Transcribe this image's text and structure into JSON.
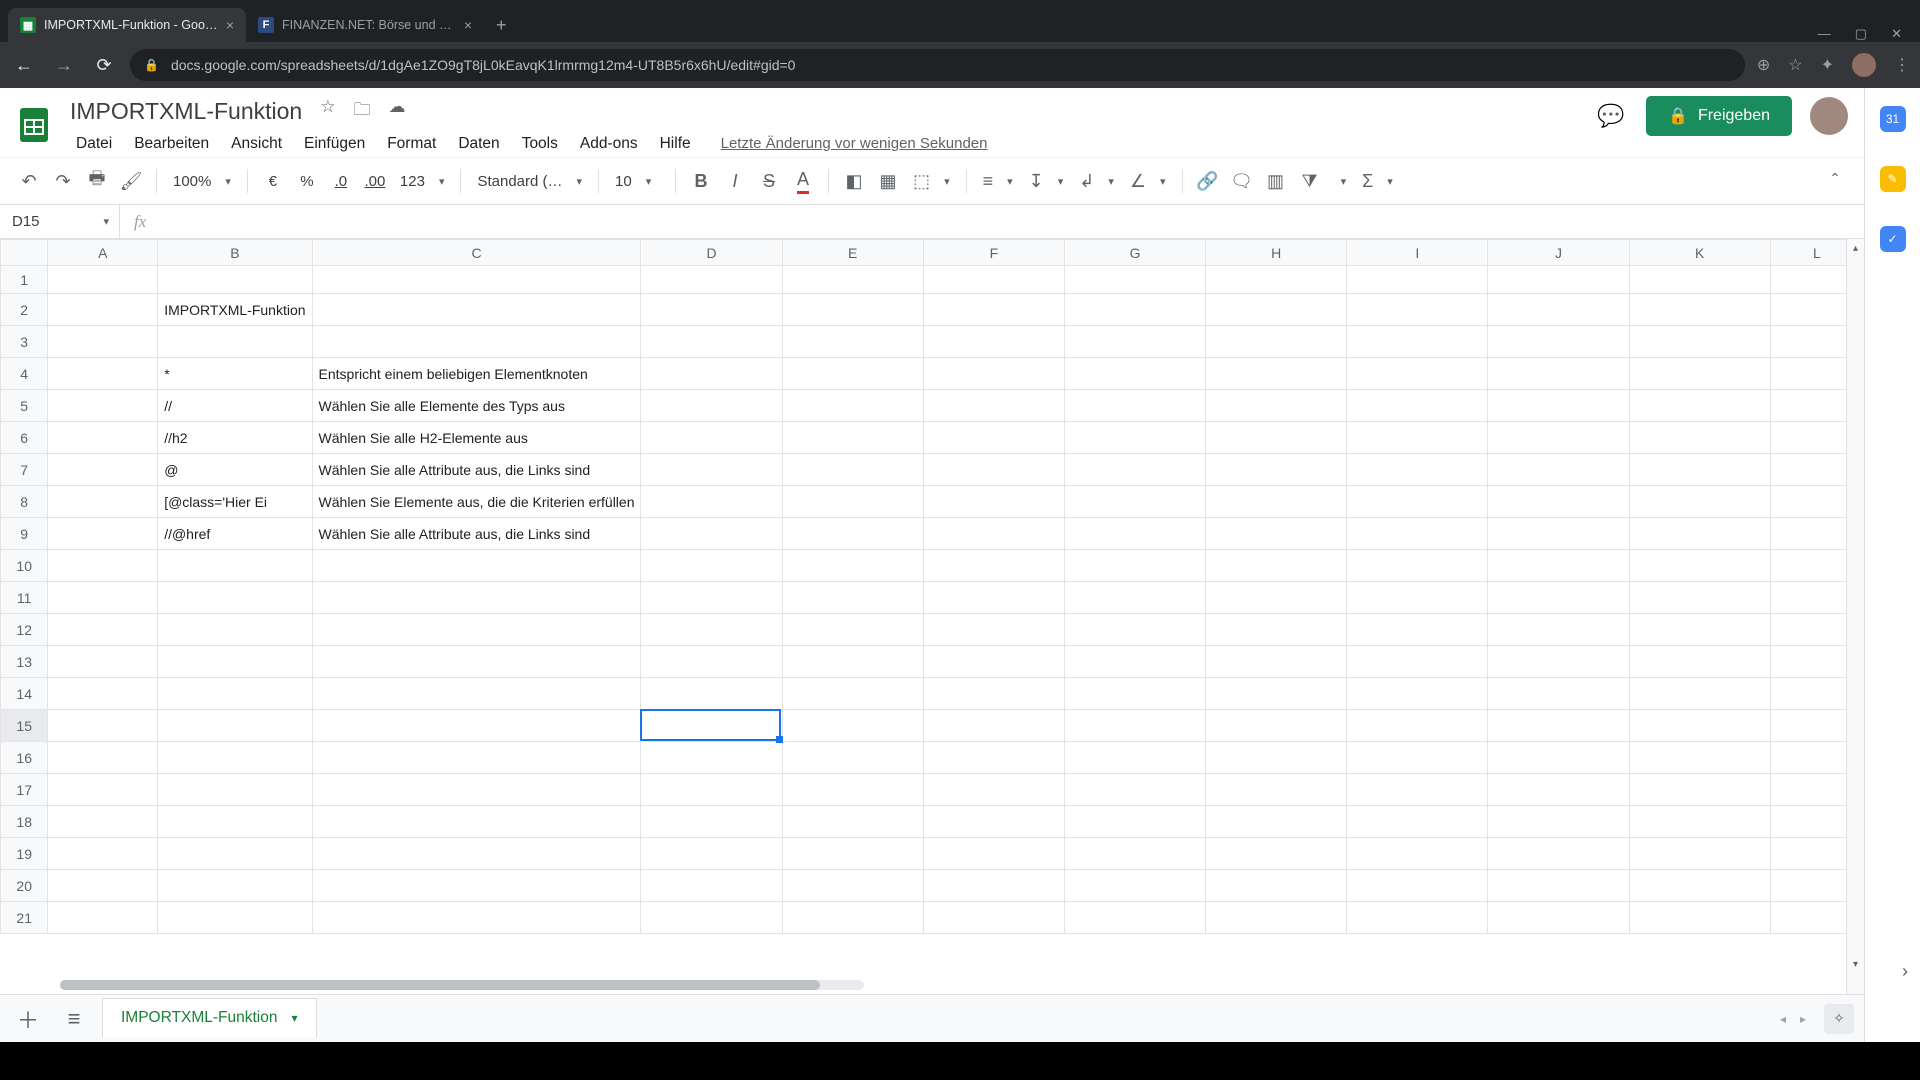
{
  "browser": {
    "tabs": [
      {
        "title": "IMPORTXML-Funktion - Google",
        "active": true
      },
      {
        "title": "FINANZEN.NET: Börse und Finan",
        "active": false
      }
    ],
    "url": "docs.google.com/spreadsheets/d/1dgAe1ZO9gT8jL0kEavqK1lrmrmg12m4-UT8B5r6x6hU/edit#gid=0"
  },
  "doc": {
    "title": "IMPORTXML-Funktion",
    "last_edit": "Letzte Änderung vor wenigen Sekunden",
    "share_label": "Freigeben"
  },
  "menus": {
    "file": "Datei",
    "edit": "Bearbeiten",
    "view": "Ansicht",
    "insert": "Einfügen",
    "format": "Format",
    "data": "Daten",
    "tools": "Tools",
    "addons": "Add-ons",
    "help": "Hilfe"
  },
  "toolbar": {
    "zoom": "100%",
    "currency": "€",
    "percent": "%",
    "dec_dec": ".0",
    "inc_dec": ".00",
    "num_format": "123",
    "font": "Standard (…",
    "font_size": "10"
  },
  "name_box": "D15",
  "columns": [
    "A",
    "B",
    "C",
    "D",
    "E",
    "F",
    "G",
    "H",
    "I",
    "J",
    "K",
    "L"
  ],
  "rows": 21,
  "selected": {
    "col": "D",
    "row": 15
  },
  "cells": {
    "B2": "IMPORTXML-Funktion",
    "B4": "*",
    "C4": "Entspricht einem beliebigen Elementknoten",
    "B5": "//",
    "C5": "Wählen Sie alle Elemente des Typs aus",
    "B6": "//h2",
    "C6": "Wählen Sie alle H2-Elemente aus",
    "B7": "@",
    "C7": "Wählen Sie alle Attribute aus, die Links sind",
    "B8": "[@class='Hier Ei",
    "C8": "Wählen Sie Elemente aus, die die Kriterien erfüllen",
    "B9": "//@href",
    "C9": "Wählen Sie alle Attribute aus, die Links sind"
  },
  "sheet_tab": "IMPORTXML-Funktion"
}
